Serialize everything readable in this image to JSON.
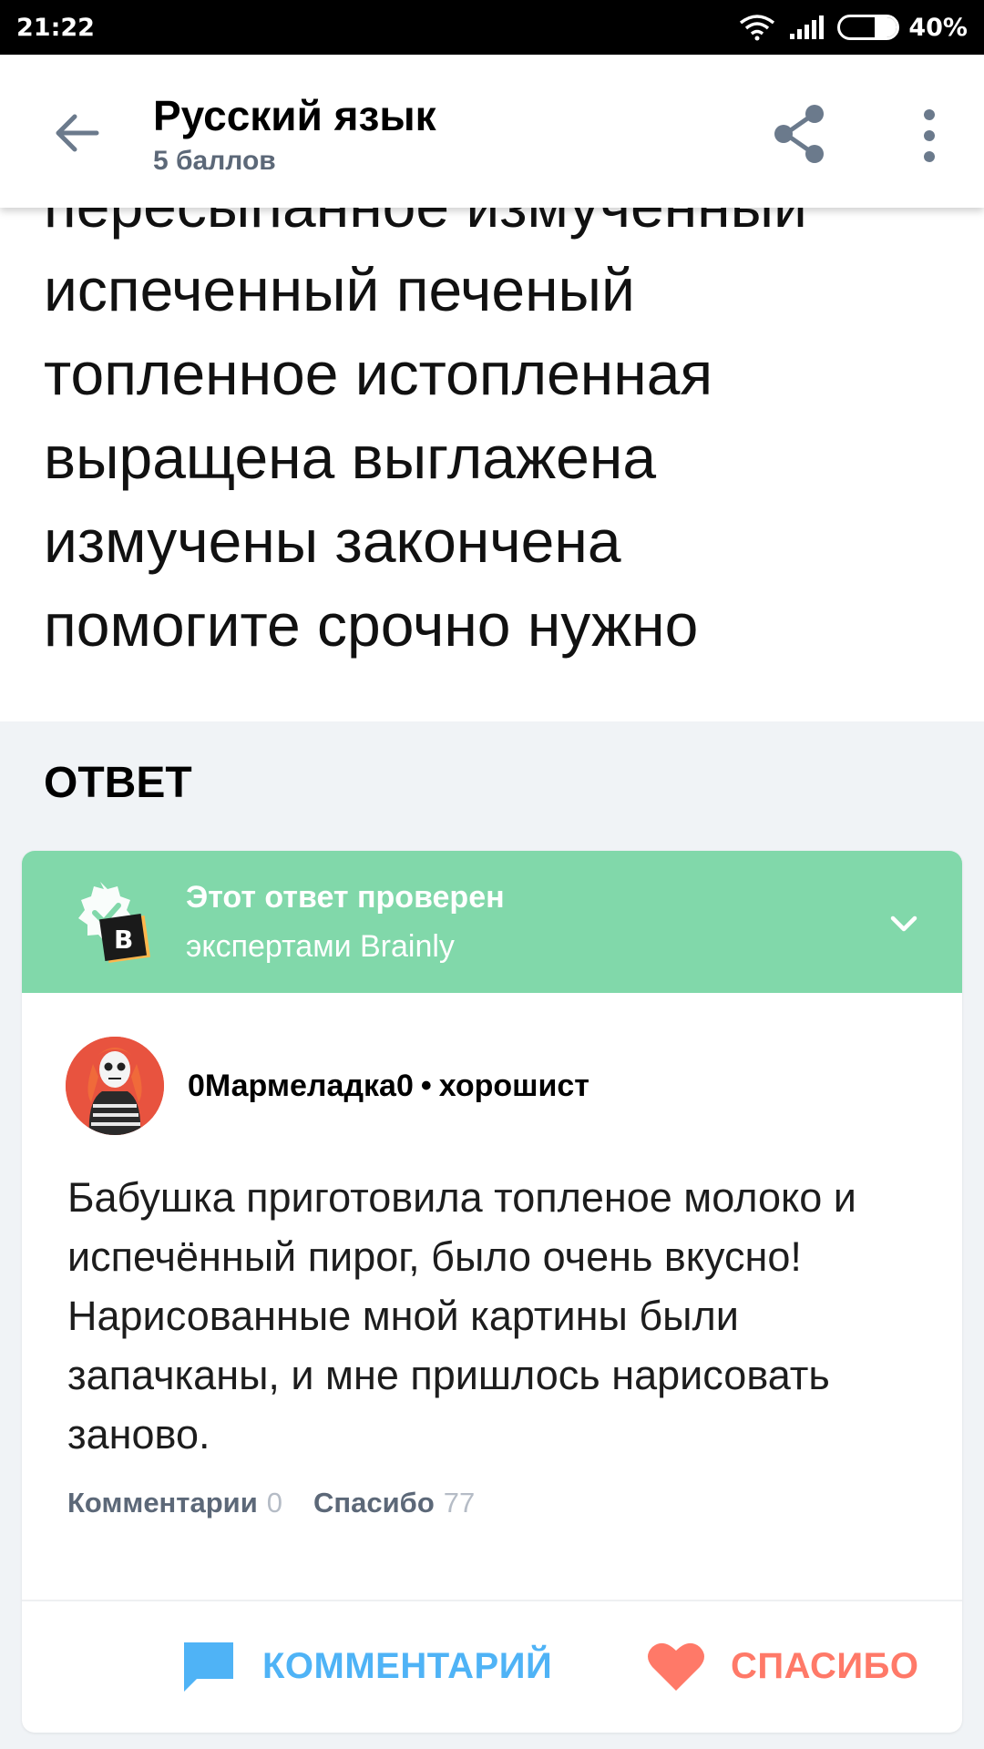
{
  "status_bar": {
    "time": "21:22",
    "battery": "40%",
    "battery_level": 0.4
  },
  "header": {
    "title": "Русский язык",
    "points": "5 баллов",
    "back_icon": "arrow-left-icon",
    "share_icon": "share-icon",
    "more_icon": "more-vertical-icon"
  },
  "question": {
    "text": "пересыпанное измученный\nиспеченный печеный\nтопленное истопленная\nвыращена выглажена\nизмучены закончена\nпомогите срочно нужно"
  },
  "answer_section": {
    "heading": "ОТВЕТ"
  },
  "verified_banner": {
    "title": "Этот ответ проверен",
    "subtitle": "экспертами Brainly",
    "color": "#81d8aa",
    "icon": "verified-badge-icon",
    "badge_letter": "B"
  },
  "answer": {
    "author": "0Мармеладка0",
    "separator": "•",
    "rank": "хорошист",
    "text": "Бабушка приготовила топленое молоко и испечённый пирог, было очень вкусно! Нарисованные мной картины были запачканы, и мне пришлось нарисовать заново.",
    "comments_label": "Комментарии",
    "comments_count": "0",
    "thanks_label": "Спасибо",
    "thanks_count": "77"
  },
  "actions": {
    "comment_label": "КОММЕНТАРИЙ",
    "thanks_label": "СПАСИБО",
    "comment_color": "#4fb3f6",
    "thanks_color": "#ff7968"
  }
}
